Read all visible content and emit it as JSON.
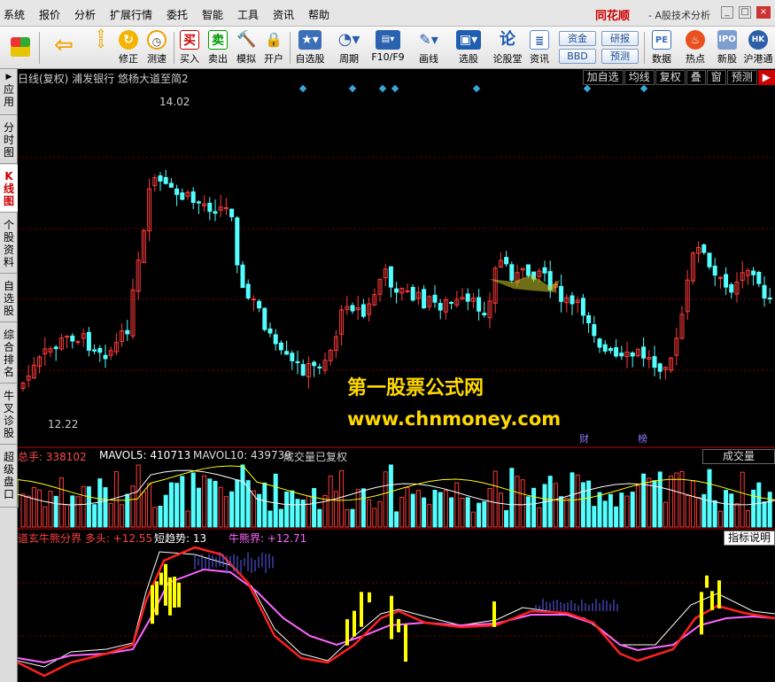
{
  "menubar": {
    "items": [
      "系统",
      "报价",
      "分析",
      "扩展行情",
      "委托",
      "智能",
      "工具",
      "资讯",
      "帮助"
    ],
    "brand": "同花顺",
    "brand_sub": "- A股技术分析",
    "win_min": "_",
    "win_max": "□",
    "win_close": "×"
  },
  "toolbar": {
    "buttons": [
      {
        "label": "",
        "icon": "grid-icon"
      },
      {
        "label": "",
        "icon": "back-arrow-icon"
      },
      {
        "label": "",
        "icon": "up-down-arrow-icon"
      },
      {
        "label": "修正",
        "icon": "refresh-icon"
      },
      {
        "label": "测速",
        "icon": "clock-icon"
      },
      {
        "label": "买入",
        "icon": "buy-icon",
        "glyph": "买"
      },
      {
        "label": "卖出",
        "icon": "sell-icon",
        "glyph": "卖"
      },
      {
        "label": "模拟",
        "icon": "hammer-icon"
      },
      {
        "label": "开户",
        "icon": "lock-icon"
      },
      {
        "label": "自选股",
        "icon": "star-icon"
      },
      {
        "label": "周期",
        "icon": "period-icon"
      },
      {
        "label": "F10/F9",
        "icon": "f10-icon"
      },
      {
        "label": "画线",
        "icon": "pen-icon"
      },
      {
        "label": "选股",
        "icon": "stock-picker-icon"
      },
      {
        "label": "论股堂",
        "icon": "forum-icon",
        "glyph": "论"
      },
      {
        "label": "资讯",
        "icon": "news-icon"
      },
      {
        "label": "数据",
        "icon": "pe-icon",
        "glyph": "PE"
      },
      {
        "label": "热点",
        "icon": "hot-icon"
      },
      {
        "label": "新股",
        "icon": "ipo-icon"
      },
      {
        "label": "沪港通",
        "icon": "hk-connect-icon"
      }
    ],
    "pills": [
      "资金",
      "研报",
      "BBD",
      "预测"
    ]
  },
  "left_tabs": [
    {
      "label": "应用",
      "active": false
    },
    {
      "label": "分时图",
      "active": false
    },
    {
      "label": "K线图",
      "active": true
    },
    {
      "label": "个股资料",
      "active": false
    },
    {
      "label": "自选股",
      "active": false
    },
    {
      "label": "综合排名",
      "active": false
    },
    {
      "label": "牛叉诊股",
      "active": false
    },
    {
      "label": "超级盘口",
      "active": false
    }
  ],
  "kline": {
    "title": "日线(复权)  浦发银行  悠杨大道至简2",
    "high_label": "14.02",
    "low_label": "12.22",
    "buttons": [
      "加自选",
      "均线",
      "复权",
      "叠",
      "窗",
      "预测"
    ],
    "more_button": "▶",
    "events": [
      "财",
      "榜"
    ]
  },
  "volume": {
    "label_total": "总手: 338102",
    "label_ma5": "MAVOL5: 410713",
    "label_ma10": "MAVOL10: 439739",
    "note": "成交量已复权",
    "button": "成交量"
  },
  "indicator": {
    "label_main": "道玄牛熊分界 多头: +12.55",
    "label_short": "短趋势: 13",
    "label_bull": "牛熊界: +12.71",
    "button": "指标说明"
  },
  "watermark": {
    "line1": "第一股票公式网",
    "line2": "www.chnmoney.com"
  },
  "colors": {
    "up": "#ff3a3a",
    "down": "#54ffff",
    "ma_white": "#ffffff",
    "ma_yellow": "#ffff00",
    "magenta": "#ff66ff",
    "red_line": "#ff2020",
    "grid_red": "#7a0000",
    "marker": "#3aa6d8"
  }
}
